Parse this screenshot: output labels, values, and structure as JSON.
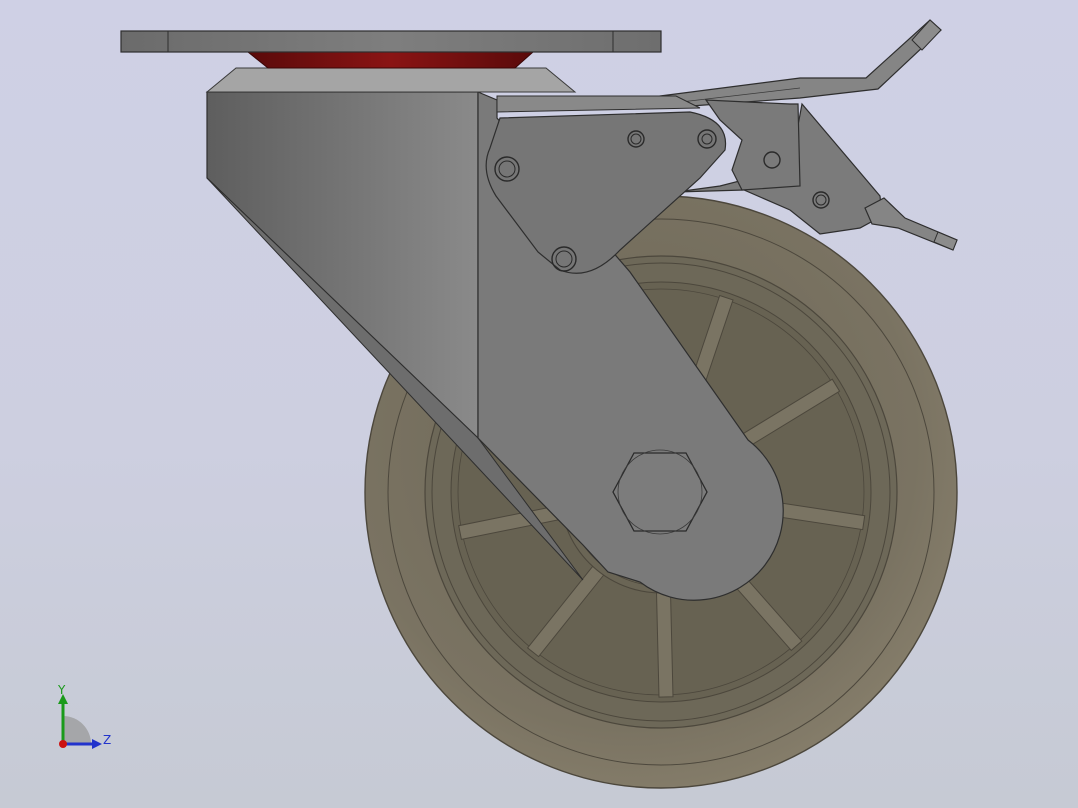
{
  "triad": {
    "y_label": "Y",
    "z_label": "Z",
    "colors": {
      "y_axis": "#1a9a1a",
      "z_axis": "#2233cc",
      "x_axis": "#cc1111"
    }
  },
  "scene": {
    "background_top": "#cfd0e5",
    "background_bottom": "#c6cad4",
    "part_colors": {
      "metal": "#7a7a7a",
      "wheel_tread": "#7c7565",
      "wheel_hub": "#6c6758",
      "bearing_ring": "#7a1010"
    }
  }
}
